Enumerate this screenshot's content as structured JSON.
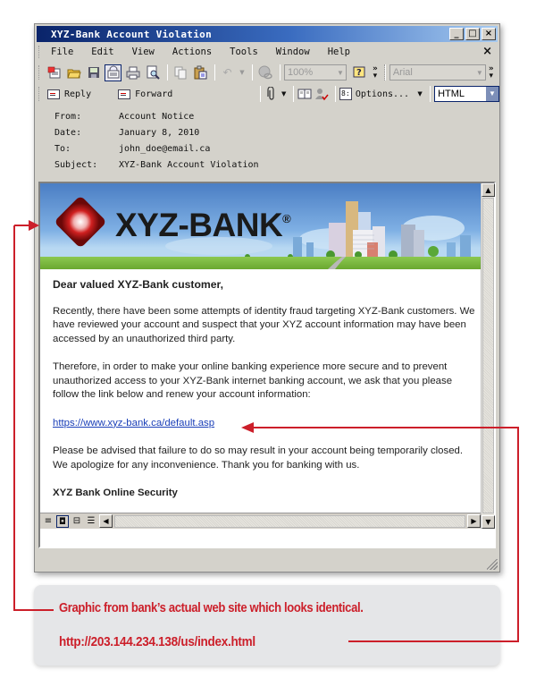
{
  "window": {
    "title": "XYZ-Bank Account Violation",
    "controls": {
      "minimize": "_",
      "maximize": "□",
      "close": "×"
    }
  },
  "menubar": {
    "items": [
      "File",
      "Edit",
      "View",
      "Actions",
      "Tools",
      "Window",
      "Help"
    ],
    "close": "×"
  },
  "toolbar": {
    "icons": [
      "new-message-icon",
      "open-icon",
      "save-icon",
      "message-options-icon",
      "print-icon",
      "print-preview-icon",
      "copy-icon",
      "paste-icon",
      "undo-icon",
      "web-link-icon"
    ],
    "zoom_value": "100%",
    "help_icon": "help-icon",
    "font_value": "Arial"
  },
  "toolbar2": {
    "reply_label": "Reply",
    "forward_label": "Forward",
    "options_label": "Options...",
    "format_value": "HTML"
  },
  "headers": {
    "from_label": "From:",
    "from_value": "Account Notice",
    "date_label": "Date:",
    "date_value": "January 8, 2010",
    "to_label": "To:",
    "to_value": "john_doe@email.ca",
    "subject_label": "Subject:",
    "subject_value": "XYZ-Bank Account Violation"
  },
  "email": {
    "brand": "XYZ-BANK",
    "brand_mark": "®",
    "greeting": "Dear valued XYZ-Bank customer,",
    "paragraph1": "Recently, there have been some attempts of identity fraud targeting XYZ-Bank customers. We have reviewed your account and suspect that your XYZ account information may have been accessed by an unauthorized third party.",
    "paragraph2": "Therefore, in order to make your online banking experience more secure and to prevent unauthorized access to your XYZ-Bank internet banking account, we ask that you please follow the link below and renew your account information:",
    "link": "https://www.xyz-bank.ca/default.asp",
    "paragraph3": "Please be advised that failure to do so may result in your account being temporarily closed. We apologize for any inconvenience. Thank you for banking with us.",
    "signature": "XYZ Bank Online Security"
  },
  "annotation": {
    "line1": "Graphic from bank’s actual web site which looks identical.",
    "line2": "http://203.144.234.138/us/index.html",
    "color": "#cc1f2a"
  }
}
